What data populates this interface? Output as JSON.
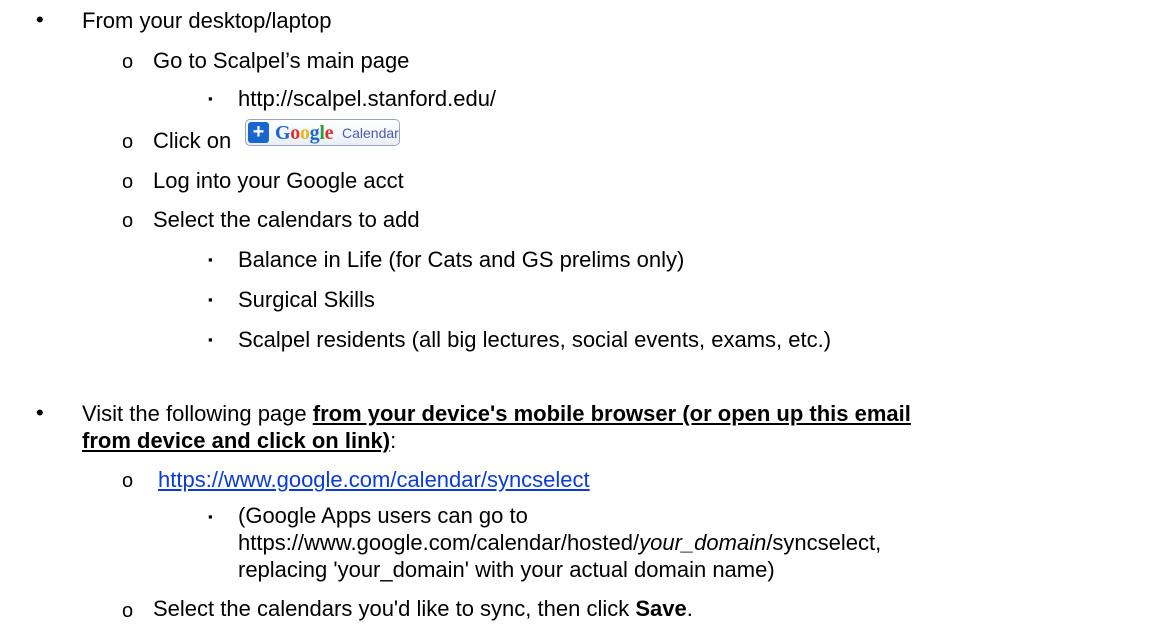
{
  "bullets": {
    "l1": "•",
    "l2": "o",
    "l3": "▪"
  },
  "desktop": {
    "heading": "From your desktop/laptop",
    "step1": "Go to Scalpel’s main page",
    "step1_url": "http://scalpel.stanford.edu/",
    "step2_prefix": "Click on",
    "step3": "Log into your Google acct",
    "step4": "Select the calendars to add",
    "calendars": [
      "Balance in Life (for Cats and GS prelims only)",
      "Surgical Skills",
      "Scalpel residents (all big lectures, social events, exams, etc.)"
    ]
  },
  "gcal_button": {
    "plus": "+",
    "letters": [
      {
        "ch": "G",
        "color": "#1a66cc"
      },
      {
        "ch": "o",
        "color": "#d9302c"
      },
      {
        "ch": "o",
        "color": "#e8b417"
      },
      {
        "ch": "g",
        "color": "#1a66cc"
      },
      {
        "ch": "l",
        "color": "#2e9d3c"
      },
      {
        "ch": "e",
        "color": "#d9302c"
      }
    ],
    "calendar": "Calendar"
  },
  "mobile": {
    "prefix": "Visit the following page ",
    "emph_line1": "from your device's mobile browser (or open up this email",
    "emph_line2": "from device and click on link)",
    "suffix": ":",
    "link": "https://www.google.com/calendar/syncselect",
    "note_line1": "(Google Apps users can go to",
    "note_line2_a": "https://www.google.com/calendar/hosted/",
    "note_line2_em": "your_domain",
    "note_line2_b": "/syncselect,",
    "note_line3": "replacing 'your_domain' with your actual domain name)",
    "final_a": "Select the calendars you'd like to sync, then click ",
    "final_b": "Save",
    "final_c": "."
  }
}
